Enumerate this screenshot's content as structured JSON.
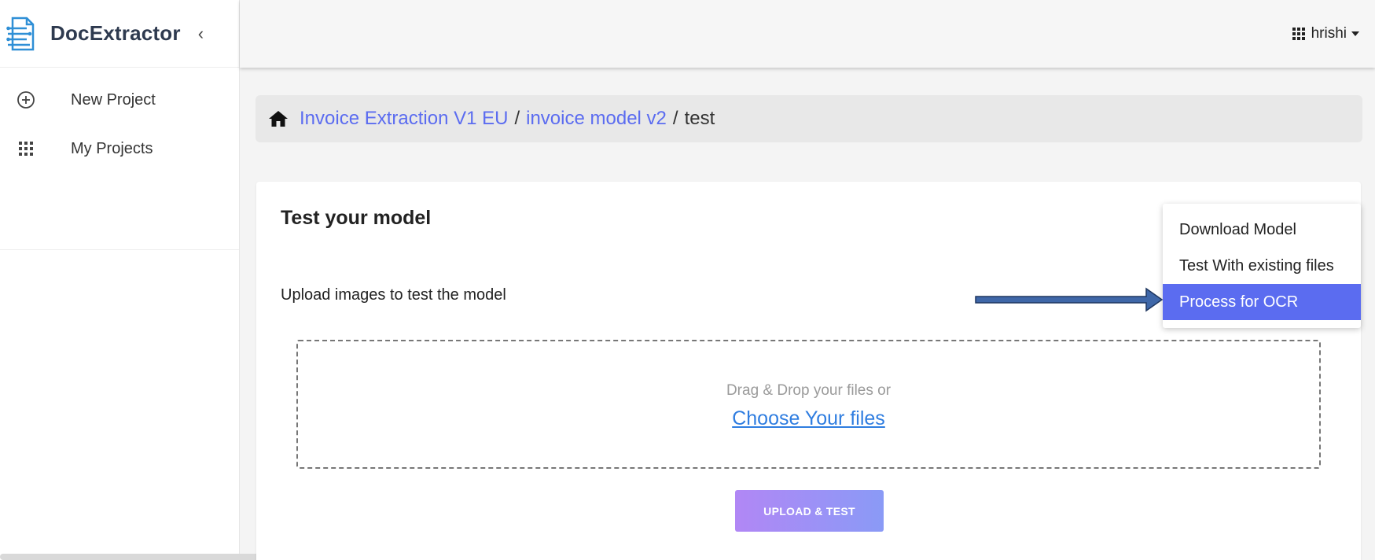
{
  "app": {
    "name": "DocExtractor"
  },
  "sidebar": {
    "items": [
      {
        "label": "New Project",
        "icon": "plus-circle-icon"
      },
      {
        "label": "My Projects",
        "icon": "grid-icon"
      }
    ]
  },
  "topbar": {
    "user": "hrishi"
  },
  "breadcrumb": {
    "items": [
      {
        "label": "Invoice Extraction V1 EU"
      },
      {
        "label": "invoice model v2"
      }
    ],
    "separator": "/",
    "current": "test"
  },
  "card": {
    "title": "Test your model",
    "upload_label": "Upload images to test the model",
    "drop_text": "Drag & Drop your files or",
    "choose_link": "Choose Your files",
    "upload_button": "UPLOAD & TEST"
  },
  "dropdown": {
    "items": [
      {
        "label": "Download Model"
      },
      {
        "label": "Test With existing files"
      },
      {
        "label": "Process for OCR"
      }
    ],
    "active_item": "Process for OCR"
  },
  "colors": {
    "accent": "#5b6cf0",
    "link": "#2f7de0",
    "arrow_fill": "#3f67a8",
    "arrow_stroke": "#1f3760"
  }
}
